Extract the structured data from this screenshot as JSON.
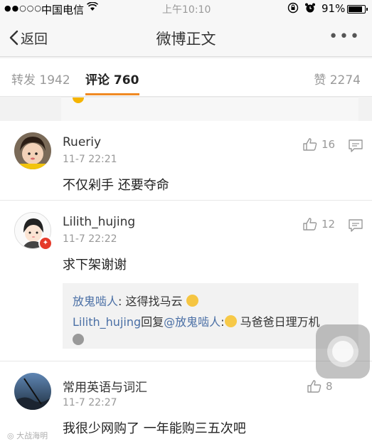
{
  "status_bar": {
    "signal": "●●○○○",
    "carrier": "中国电信",
    "time": "上午10:10",
    "battery_percent": "91%",
    "battery_level": 0.91
  },
  "nav": {
    "back_label": "返回",
    "title": "微博正文",
    "more_label": "•••"
  },
  "tabs": {
    "repost": "转发 1942",
    "comment": "评论 760",
    "like": "赞 2274"
  },
  "comments": [
    {
      "username": "Rueriy",
      "time": "11-7 22:21",
      "likes": "16",
      "text": "不仅剁手 还要夺命"
    },
    {
      "username": "Lilith_hujing",
      "time": "11-7 22:22",
      "likes": "12",
      "text": "求下架谢谢",
      "replies": {
        "reply1_user": "放鬼啮人",
        "reply1_text": ": 这得找马云",
        "reply2_user": "Lilith_hujing",
        "reply2_mid": "回复",
        "reply2_target": "@放鬼啮人",
        "reply2_colon": ":",
        "reply2_text": " 马爸爸日理万机"
      }
    },
    {
      "username": "常用英语与词汇",
      "time": "11-7 22:27",
      "likes": "8",
      "text": "我很少网购了 一年能购三五次吧"
    }
  ],
  "watermark": "大战海明",
  "colors": {
    "accent": "#f08a24",
    "link": "#4a6fa5",
    "vip_badge": "#e53b2b"
  }
}
